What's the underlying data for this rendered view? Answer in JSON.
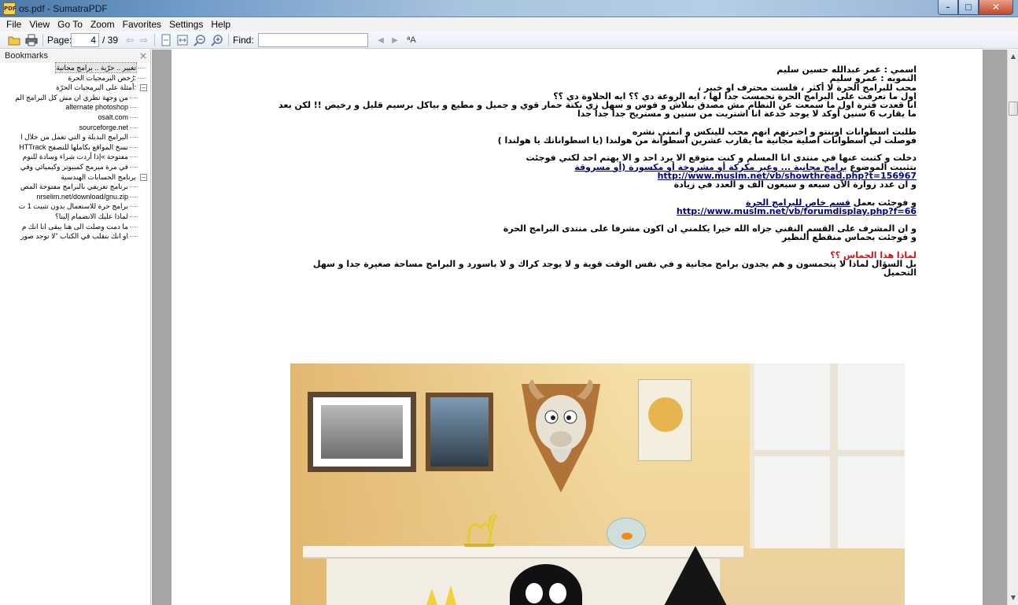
{
  "window": {
    "title": "os.pdf - SumatraPDF",
    "icon_label": "PDF",
    "controls": {
      "minimize": "–",
      "maximize": "□",
      "close": "✕"
    }
  },
  "menu": [
    "File",
    "View",
    "Go To",
    "Zoom",
    "Favorites",
    "Settings",
    "Help"
  ],
  "toolbar": {
    "page_label": "Page:",
    "page_value": "4",
    "page_total": "/ 39",
    "find_label": "Find:",
    "find_value": "",
    "icons": [
      "open-icon",
      "print-icon",
      "prev-page-icon",
      "next-page-icon",
      "fit-page-icon",
      "fit-width-icon",
      "zoom-out-icon",
      "zoom-in-icon",
      "find-prev-icon",
      "find-next-icon",
      "match-case-icon"
    ]
  },
  "sidebar": {
    "title": "Bookmarks",
    "close": "×",
    "items": [
      {
        "label": "تغيير .. حرّية .. برامج مجانية",
        "level": 0,
        "toggle": "",
        "selected": true
      },
      {
        "label": "رُخص البرمجيات الحرة:",
        "level": 0,
        "toggle": "",
        "selected": false
      },
      {
        "label": "أمثلة على البرمجيات الحرّة:",
        "level": 0,
        "toggle": "–",
        "selected": false
      },
      {
        "label": "من وجهة نظري ان مش كل البرامج الم",
        "level": 1,
        "toggle": "",
        "selected": false
      },
      {
        "label": "alternate photoshop",
        "level": 1,
        "toggle": "",
        "selected": false
      },
      {
        "label": "osalt.com",
        "level": 1,
        "toggle": "",
        "selected": false
      },
      {
        "label": "sourceforge.net",
        "level": 1,
        "toggle": "",
        "selected": false
      },
      {
        "label": "البرامج البديلة و التي تعمل من خلال ا",
        "level": 1,
        "toggle": "",
        "selected": false
      },
      {
        "label": "HTTrack نسخ المواقع بكاملها للتصفح",
        "level": 1,
        "toggle": "",
        "selected": false
      },
      {
        "label": "مفتوحة »إذا أردت شراء وسادة للنوم",
        "level": 1,
        "toggle": "",
        "selected": false
      },
      {
        "label": "في مرة ميرمج كمبيوتر وكيميائي وفي",
        "level": 1,
        "toggle": "",
        "selected": false
      },
      {
        "label": "برنامج الحسابات الهندسية",
        "level": 0,
        "toggle": "–",
        "selected": false
      },
      {
        "label": "برنامج تعريفي بالبرامج مفتوحة المص",
        "level": 1,
        "toggle": "",
        "selected": false
      },
      {
        "label": "nrselim.net/download/gnu.zip",
        "level": 1,
        "toggle": "",
        "selected": false
      },
      {
        "label": "برامج حرة للاستعمال بدون تثبيت 1 ت",
        "level": 1,
        "toggle": "",
        "selected": false
      },
      {
        "label": "لماذا عليك الانضمام إلينا؟",
        "level": 1,
        "toggle": "",
        "selected": false
      },
      {
        "label": "ما دمت وصلت الى هنا يبقى انا انك م",
        "level": 1,
        "toggle": "",
        "selected": false
      },
      {
        "label": "او انك بتقلب في الكتاب \"لا توجد صور",
        "level": 1,
        "toggle": "",
        "selected": false
      }
    ]
  },
  "document": {
    "lines": [
      {
        "text": "اسمي : عمر عبدالله حسين سليم",
        "style": "normal"
      },
      {
        "text": "التمويه : عمرو سليم",
        "style": "normal"
      },
      {
        "text": "محب للبرامج الحرة لا أكثر ، فلست محترف او خبير ،",
        "style": "normal"
      },
      {
        "text": "اول ما تعرفت على البرامج الحرة تحمست جدا لها ، ايه الروعة دي ؟؟ ايه الحلاوة دي ؟؟",
        "style": "normal"
      },
      {
        "text": "انا قعدت فترة اول ما سمعت عن النظام مش مصدق ببلاش و فوس و سهل زي نكتة حمار قوي و جميل و مطيع و بياكل برسيم قليل و رخيص !! لكن بعد",
        "style": "normal"
      },
      {
        "text": "ما يقارب 6 سنين أوكد لا يوجد خدعة انا اشتريت من سنين و مستريح جدا جدا جدا",
        "style": "normal"
      },
      {
        "text": "",
        "style": "gap"
      },
      {
        "text": "طلبت اسطوانات اوبنتو و اخبرتهم انهم محب للينكس و انمني نشره",
        "style": "normal"
      },
      {
        "text": "فوصلت لي اسطوانات اصلية مجانية ما يقارب عشرين اسطوانة من هولندا (يا اسطواناتك يا هولندا )",
        "style": "normal"
      },
      {
        "text": "",
        "style": "gap"
      },
      {
        "text": "دخلت و كتبت عنها في منتدى انا المسلم و كنت متوقع الا يرد احد و الا يهتم احد لكني فوجئت",
        "style": "normal"
      },
      {
        "prefix": "بتثبيت الموضوع ",
        "text": "برامج مجانية ... وغير مكركة أو مشروخة أو مكسورة (أو مسروقة",
        "style": "mixed-link"
      },
      {
        "text": "http://www.muslm.net/vb/showthread.php?t=156967",
        "style": "url"
      },
      {
        "text": "و ان عدد زوارة الآن سبعه و سبعون الف و العدد في زيادة",
        "style": "normal"
      },
      {
        "text": "",
        "style": "gap"
      },
      {
        "prefix": "و فوجئت بعمل ",
        "text": "قسم خاص للبرامج الحرة",
        "style": "mixed-link"
      },
      {
        "text": "http://www.muslm.net/vb/forumdisplay.php?f=66",
        "style": "url"
      },
      {
        "text": "",
        "style": "gap"
      },
      {
        "text": "و ان المشرف على القسم النفني جزاه الله خيرا يكلمني ان اكون مشرفا على منتدى البرامج الحرة",
        "style": "normal"
      },
      {
        "text": "و فوجئت بحماس منقطع النظير",
        "style": "normal"
      },
      {
        "text": "",
        "style": "gap"
      },
      {
        "text": "لماذا هذا الحماس ؟؟",
        "style": "red"
      },
      {
        "text": "بل السؤال لماذا لا يتحمسون و هم يجدون برامج مجانية و في نفس الوقت قوية و لا يوجد كراك و لا باسورد و البرامج مساحة صغيرة جدا و سهل",
        "style": "normal"
      },
      {
        "text": "التحميل",
        "style": "normal"
      }
    ]
  },
  "colors": {
    "link": "#00006a",
    "heading_red": "#c81414",
    "doc_background": "#a5a5a5",
    "selection": "#e5e5e5"
  }
}
